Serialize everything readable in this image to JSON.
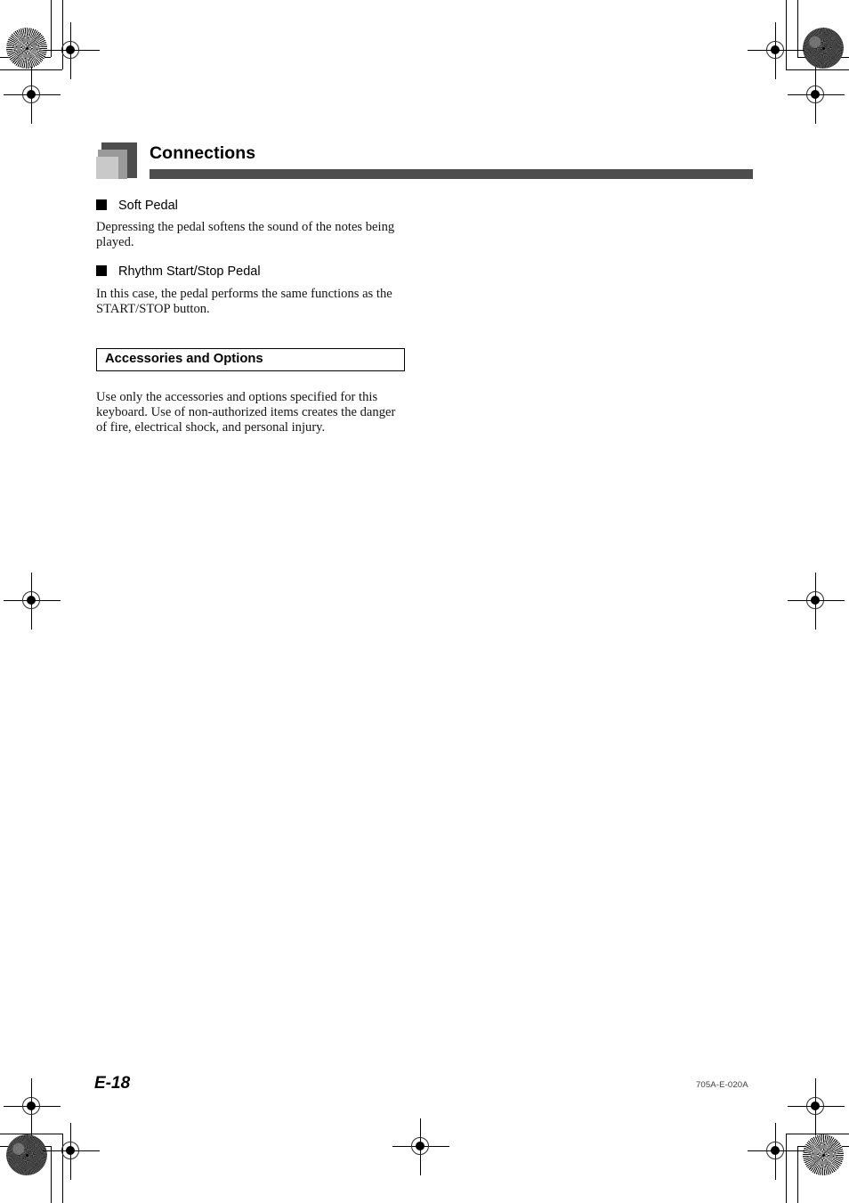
{
  "document": {
    "chapter": {
      "title": "Connections",
      "logo_icon": "nested-squares-icon"
    },
    "sections": [
      {
        "heading": "Soft Pedal",
        "bullet_icon": "filled-square-bullet-icon",
        "body": "Depressing the pedal softens the sound of the notes being played."
      },
      {
        "heading": "Rhythm Start/Stop Pedal",
        "bullet_icon": "filled-square-bullet-icon",
        "body": "In this case, the pedal performs the same functions as the START/STOP button."
      }
    ],
    "boxed_section": {
      "label": "Accessories and Options",
      "body": "Use only the accessories and options specified for this keyboard. Use of non-authorized items creates the danger of fire, electrical shock, and personal injury."
    },
    "footer": {
      "page_number": "E-18",
      "doc_code": "705A-E-020A"
    }
  },
  "colors": {
    "rule_gray": "#4d4d4d",
    "logo_dark": "#4d4d4d",
    "logo_mid": "#9a9a9a",
    "logo_light": "#c9c9c9",
    "text_black": "#000000",
    "doc_code_gray": "#3c3c3c"
  },
  "prepress": {
    "registration_marks": "crosshair-registration-icon",
    "star_targets": "moire-star-target-icon",
    "trim_lines": "crop-trim-line"
  }
}
